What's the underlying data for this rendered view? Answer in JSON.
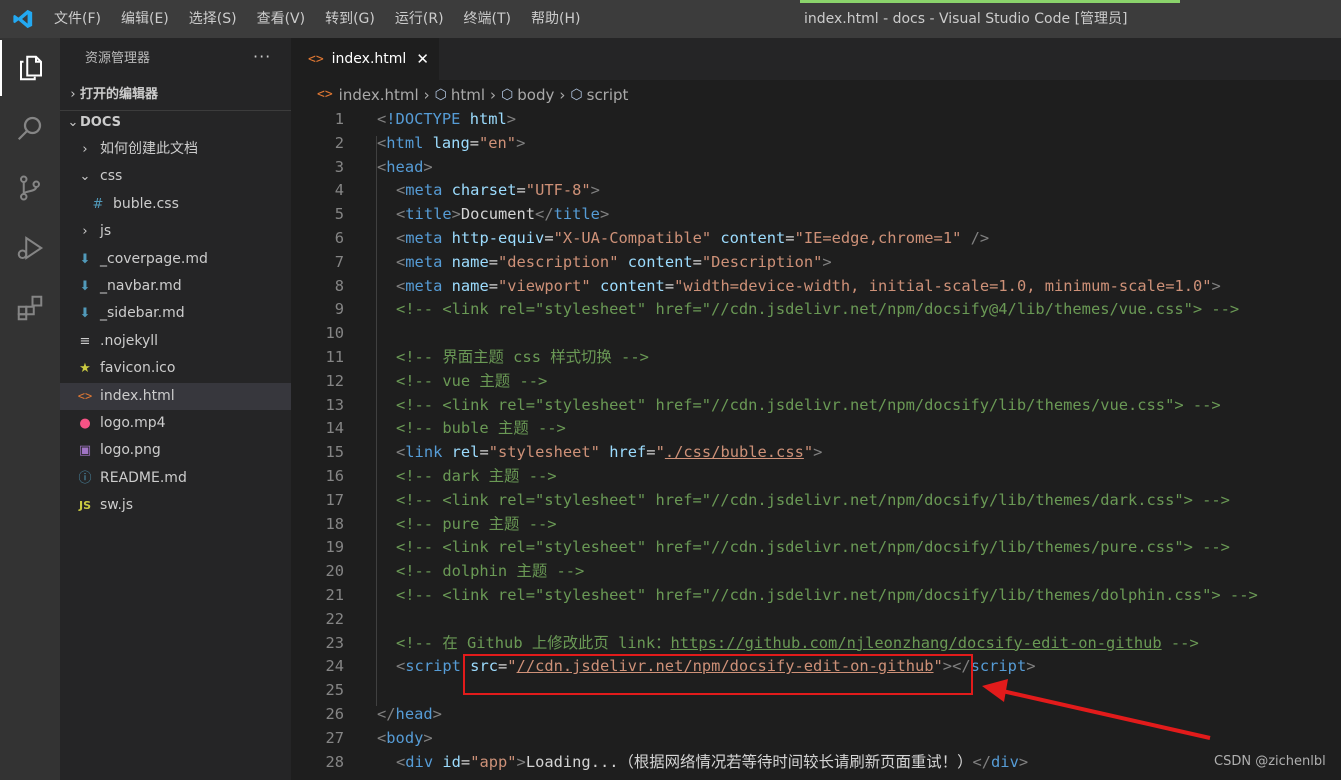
{
  "titlebar": {
    "menus": [
      "文件(F)",
      "编辑(E)",
      "选择(S)",
      "查看(V)",
      "转到(G)",
      "运行(R)",
      "终端(T)",
      "帮助(H)"
    ],
    "window_title": "index.html - docs - Visual Studio Code [管理员]"
  },
  "colors": {
    "accent_bar": "#8ad36b",
    "highlight": "#e21b1b",
    "editor_bg": "#1e1e1e"
  },
  "activity_bar": {
    "items": [
      {
        "icon": "explorer-icon",
        "active": true
      },
      {
        "icon": "search-icon"
      },
      {
        "icon": "source-control-icon"
      },
      {
        "icon": "run-debug-icon"
      },
      {
        "icon": "extensions-icon"
      }
    ]
  },
  "sidebar": {
    "title": "资源管理器",
    "more": "···",
    "open_editors": "打开的编辑器",
    "folder": "DOCS",
    "items": [
      {
        "label": "如何创建此文档",
        "type": "folder-closed",
        "depth": 1
      },
      {
        "label": "css",
        "type": "folder-open",
        "depth": 1
      },
      {
        "label": "buble.css",
        "type": "css",
        "depth": 2
      },
      {
        "label": "js",
        "type": "folder-closed",
        "depth": 1
      },
      {
        "label": "_coverpage.md",
        "type": "md",
        "depth": 1
      },
      {
        "label": "_navbar.md",
        "type": "md",
        "depth": 1
      },
      {
        "label": "_sidebar.md",
        "type": "md",
        "depth": 1
      },
      {
        "label": ".nojekyll",
        "type": "text",
        "depth": 1
      },
      {
        "label": "favicon.ico",
        "type": "ico",
        "depth": 1
      },
      {
        "label": "index.html",
        "type": "html",
        "depth": 1,
        "selected": true
      },
      {
        "label": "logo.mp4",
        "type": "mp4",
        "depth": 1
      },
      {
        "label": "logo.png",
        "type": "png",
        "depth": 1
      },
      {
        "label": "README.md",
        "type": "info",
        "depth": 1
      },
      {
        "label": "sw.js",
        "type": "js",
        "depth": 1
      }
    ]
  },
  "editor": {
    "tab": {
      "label": "index.html",
      "close": "✕"
    },
    "breadcrumb": [
      "index.html",
      "html",
      "body",
      "script"
    ],
    "lines": [
      {
        "n": "1",
        "indent": 0,
        "t": [
          [
            "p",
            "<"
          ],
          [
            "tag",
            "!DOCTYPE"
          ],
          [
            "text",
            " "
          ],
          [
            "attr",
            "html"
          ],
          [
            "p",
            ">"
          ]
        ]
      },
      {
        "n": "2",
        "indent": 0,
        "t": [
          [
            "p",
            "<"
          ],
          [
            "tag",
            "html"
          ],
          [
            "text",
            " "
          ],
          [
            "attr",
            "lang"
          ],
          [
            "text",
            "="
          ],
          [
            "str",
            "\"en\""
          ],
          [
            "p",
            ">"
          ]
        ]
      },
      {
        "n": "3",
        "indent": 0,
        "t": [
          [
            "p",
            "<"
          ],
          [
            "tag",
            "head"
          ],
          [
            "p",
            ">"
          ]
        ]
      },
      {
        "n": "4",
        "indent": 1,
        "t": [
          [
            "p",
            "<"
          ],
          [
            "tag",
            "meta"
          ],
          [
            "text",
            " "
          ],
          [
            "attr",
            "charset"
          ],
          [
            "text",
            "="
          ],
          [
            "str",
            "\"UTF-8\""
          ],
          [
            "p",
            ">"
          ]
        ]
      },
      {
        "n": "5",
        "indent": 1,
        "t": [
          [
            "p",
            "<"
          ],
          [
            "tag",
            "title"
          ],
          [
            "p",
            ">"
          ],
          [
            "text",
            "Document"
          ],
          [
            "p",
            "</"
          ],
          [
            "tag",
            "title"
          ],
          [
            "p",
            ">"
          ]
        ]
      },
      {
        "n": "6",
        "indent": 1,
        "t": [
          [
            "p",
            "<"
          ],
          [
            "tag",
            "meta"
          ],
          [
            "text",
            " "
          ],
          [
            "attr",
            "http-equiv"
          ],
          [
            "text",
            "="
          ],
          [
            "str",
            "\"X-UA-Compatible\""
          ],
          [
            "text",
            " "
          ],
          [
            "attr",
            "content"
          ],
          [
            "text",
            "="
          ],
          [
            "str",
            "\"IE=edge,chrome=1\""
          ],
          [
            "text",
            " "
          ],
          [
            "p",
            "/>"
          ]
        ]
      },
      {
        "n": "7",
        "indent": 1,
        "t": [
          [
            "p",
            "<"
          ],
          [
            "tag",
            "meta"
          ],
          [
            "text",
            " "
          ],
          [
            "attr",
            "name"
          ],
          [
            "text",
            "="
          ],
          [
            "str",
            "\"description\""
          ],
          [
            "text",
            " "
          ],
          [
            "attr",
            "content"
          ],
          [
            "text",
            "="
          ],
          [
            "str",
            "\"Description\""
          ],
          [
            "p",
            ">"
          ]
        ]
      },
      {
        "n": "8",
        "indent": 1,
        "t": [
          [
            "p",
            "<"
          ],
          [
            "tag",
            "meta"
          ],
          [
            "text",
            " "
          ],
          [
            "attr",
            "name"
          ],
          [
            "text",
            "="
          ],
          [
            "str",
            "\"viewport\""
          ],
          [
            "text",
            " "
          ],
          [
            "attr",
            "content"
          ],
          [
            "text",
            "="
          ],
          [
            "str",
            "\"width=device-width, initial-scale=1.0, minimum-scale=1.0\""
          ],
          [
            "p",
            ">"
          ]
        ]
      },
      {
        "n": "9",
        "indent": 1,
        "t": [
          [
            "com",
            "<!-- <link rel=\"stylesheet\" href=\"//cdn.jsdelivr.net/npm/docsify@4/lib/themes/vue.css\"> -->"
          ]
        ]
      },
      {
        "n": "10",
        "indent": 0,
        "t": []
      },
      {
        "n": "11",
        "indent": 1,
        "t": [
          [
            "com",
            "<!-- 界面主题 css 样式切换 -->"
          ]
        ]
      },
      {
        "n": "12",
        "indent": 1,
        "t": [
          [
            "com",
            "<!-- vue 主题 -->"
          ]
        ]
      },
      {
        "n": "13",
        "indent": 1,
        "t": [
          [
            "com",
            "<!-- <link rel=\"stylesheet\" href=\"//cdn.jsdelivr.net/npm/docsify/lib/themes/vue.css\"> -->"
          ]
        ]
      },
      {
        "n": "14",
        "indent": 1,
        "t": [
          [
            "com",
            "<!-- buble 主题 -->"
          ]
        ]
      },
      {
        "n": "15",
        "indent": 1,
        "t": [
          [
            "p",
            "<"
          ],
          [
            "tag",
            "link"
          ],
          [
            "text",
            " "
          ],
          [
            "attr",
            "rel"
          ],
          [
            "text",
            "="
          ],
          [
            "str",
            "\"stylesheet\""
          ],
          [
            "text",
            " "
          ],
          [
            "attr",
            "href"
          ],
          [
            "text",
            "="
          ],
          [
            "str",
            "\""
          ],
          [
            "stru",
            "./css/buble.css"
          ],
          [
            "str",
            "\""
          ],
          [
            "p",
            ">"
          ]
        ]
      },
      {
        "n": "16",
        "indent": 1,
        "t": [
          [
            "com",
            "<!-- dark 主题 -->"
          ]
        ]
      },
      {
        "n": "17",
        "indent": 1,
        "t": [
          [
            "com",
            "<!-- <link rel=\"stylesheet\" href=\"//cdn.jsdelivr.net/npm/docsify/lib/themes/dark.css\"> -->"
          ]
        ]
      },
      {
        "n": "18",
        "indent": 1,
        "t": [
          [
            "com",
            "<!-- pure 主题 -->"
          ]
        ]
      },
      {
        "n": "19",
        "indent": 1,
        "t": [
          [
            "com",
            "<!-- <link rel=\"stylesheet\" href=\"//cdn.jsdelivr.net/npm/docsify/lib/themes/pure.css\"> -->"
          ]
        ]
      },
      {
        "n": "20",
        "indent": 1,
        "t": [
          [
            "com",
            "<!-- dolphin 主题 -->"
          ]
        ]
      },
      {
        "n": "21",
        "indent": 1,
        "t": [
          [
            "com",
            "<!-- <link rel=\"stylesheet\" href=\"//cdn.jsdelivr.net/npm/docsify/lib/themes/dolphin.css\"> -->"
          ]
        ]
      },
      {
        "n": "22",
        "indent": 0,
        "t": []
      },
      {
        "n": "23",
        "indent": 1,
        "t": [
          [
            "com",
            "<!-- 在 Github 上修改此页 link："
          ],
          [
            "comu",
            "https://github.com/njleonzhang/docsify-edit-on-github"
          ],
          [
            "com",
            " -->"
          ]
        ]
      },
      {
        "n": "24",
        "indent": 1,
        "t": [
          [
            "p",
            "<"
          ],
          [
            "tag",
            "script"
          ],
          [
            "text",
            " "
          ],
          [
            "attr",
            "src"
          ],
          [
            "text",
            "="
          ],
          [
            "str",
            "\""
          ],
          [
            "stru",
            "//cdn.jsdelivr.net/npm/docsify-edit-on-github"
          ],
          [
            "str",
            "\""
          ],
          [
            "p",
            "></"
          ],
          [
            "tag",
            "script"
          ],
          [
            "p",
            ">"
          ]
        ]
      },
      {
        "n": "25",
        "indent": 0,
        "t": []
      },
      {
        "n": "26",
        "indent": 0,
        "t": [
          [
            "p",
            "</"
          ],
          [
            "tag",
            "head"
          ],
          [
            "p",
            ">"
          ]
        ]
      },
      {
        "n": "27",
        "indent": 0,
        "t": [
          [
            "p",
            "<"
          ],
          [
            "tag",
            "body"
          ],
          [
            "p",
            ">"
          ]
        ]
      },
      {
        "n": "28",
        "indent": 1,
        "t": [
          [
            "p",
            "<"
          ],
          [
            "tag",
            "div"
          ],
          [
            "text",
            " "
          ],
          [
            "attr",
            "id"
          ],
          [
            "text",
            "="
          ],
          [
            "str",
            "\"app\""
          ],
          [
            "p",
            ">"
          ],
          [
            "text",
            "Loading...（根据网络情况若等待时间较长请刷新页面重试！）"
          ],
          [
            "p",
            "</"
          ],
          [
            "tag",
            "div"
          ],
          [
            "p",
            ">"
          ]
        ]
      }
    ]
  },
  "watermark": "CSDN @zichenlbl"
}
